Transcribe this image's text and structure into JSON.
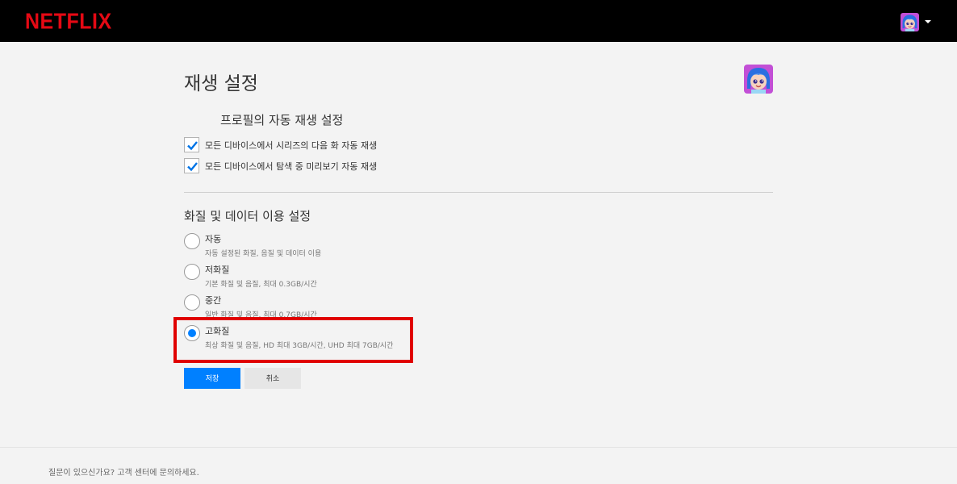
{
  "header": {
    "logo_text": "NETFLIX"
  },
  "page": {
    "title": "재생 설정"
  },
  "autoplay": {
    "heading": "프로필의 자동 재생 설정",
    "options": [
      {
        "label": "모든 디바이스에서 시리즈의 다음 화 자동 재생",
        "checked": true
      },
      {
        "label": "모든 디바이스에서 탐색 중 미리보기 자동 재생",
        "checked": true
      }
    ]
  },
  "quality": {
    "heading": "화질 및 데이터 이용 설정",
    "options": [
      {
        "label": "자동",
        "description": "자동 설정된 화질, 음질 및 데이터 이용",
        "selected": false
      },
      {
        "label": "저화질",
        "description": "기본 화질 및 음질, 최대 0.3GB/시간",
        "selected": false
      },
      {
        "label": "중간",
        "description": "일반 화질 및 음질, 최대 0.7GB/시간",
        "selected": false
      },
      {
        "label": "고화질",
        "description": "최상 화질 및 음질, HD 최대 3GB/시간, UHD 최대 7GB/시간",
        "selected": true
      }
    ]
  },
  "actions": {
    "save_label": "저장",
    "cancel_label": "취소"
  },
  "footer": {
    "help_text": "질문이 있으신가요? 고객 센터에 문의하세요."
  },
  "colors": {
    "brand": "#e50914",
    "accent": "#0080ff",
    "highlight": "#e00000"
  }
}
